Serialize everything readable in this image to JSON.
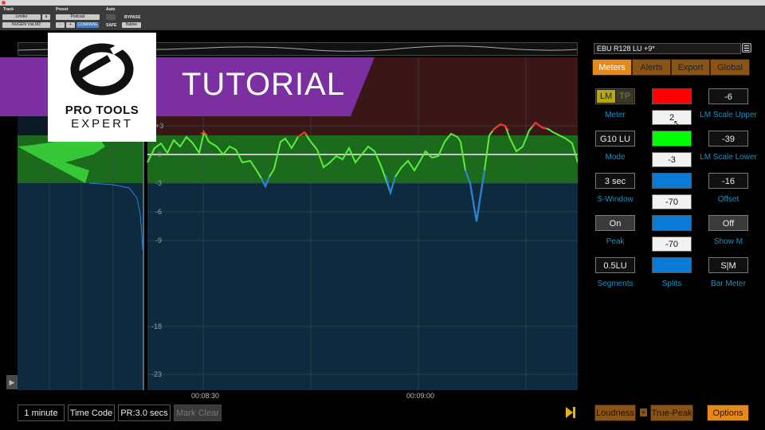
{
  "host": {
    "track_label": "Track",
    "preset_label": "Preset",
    "auto_label": "Auto",
    "track_name": "Limiter",
    "track_slot": "a",
    "preset_name": "Podcast",
    "bypass": "BYPASS",
    "plugin_name": "NUGEN VisLM2",
    "compare": "COMPARE",
    "safe": "SAFE",
    "native": "Native",
    "stepper_minus": "-",
    "stepper_plus": "+"
  },
  "overlay": {
    "tutorial": "TUTORIAL",
    "brand_line1": "PRO TOOLS",
    "brand_line2": "EXPERT"
  },
  "graph": {
    "y_ticks": [
      "+3",
      "0",
      "-3",
      "-6",
      "-9",
      "-18",
      "-23"
    ],
    "time_labels": [
      "00:08:30",
      "00:09:00"
    ],
    "colors": {
      "above": "#3a1616",
      "target": "#1c6a1c",
      "below": "#0e2a3f",
      "line_green": "#58f03a",
      "line_red": "#ff2a2a",
      "line_blue": "#2a80e0"
    }
  },
  "panel": {
    "preset": "EBU R128 LU +9*",
    "tabs": [
      "Meters",
      "Alerts",
      "Export",
      "Global"
    ],
    "active_tab": "Meters",
    "meter_lm": "LM",
    "meter_tp": "TP",
    "meter_label": "Meter",
    "mode_value": "G10 LU",
    "mode_label": "Mode",
    "swindow_value": "3 sec",
    "swindow_label": "S-Window",
    "peak_value": "On",
    "peak_label": "Peak",
    "segments_value": "0.5LU",
    "segments_label": "Segments",
    "splits_label": "Splits",
    "split_values": [
      "2",
      "-3",
      "-70",
      "-70"
    ],
    "split_colors": [
      "#ff0000",
      "#00ff00",
      "#0a7ad6",
      "#0a7ad6",
      "#0a7ad6"
    ],
    "scale_upper_value": "-6",
    "scale_upper_label": "LM Scale Upper",
    "scale_lower_value": "-39",
    "scale_lower_label": "LM Scale Lower",
    "offset_value": "-16",
    "offset_label": "Offset",
    "show_m_value": "Off",
    "show_m_label": "Show M",
    "bar_meter_value": "S|M",
    "bar_meter_label": "Bar Meter"
  },
  "bottom": {
    "range": "1 minute",
    "timecode": "Time Code",
    "pr": "PR:3.0 secs",
    "mark_clear": "Mark Clear",
    "loudness": "Loudness",
    "plus": "+",
    "true_peak": "True-Peak",
    "options": "Options"
  }
}
